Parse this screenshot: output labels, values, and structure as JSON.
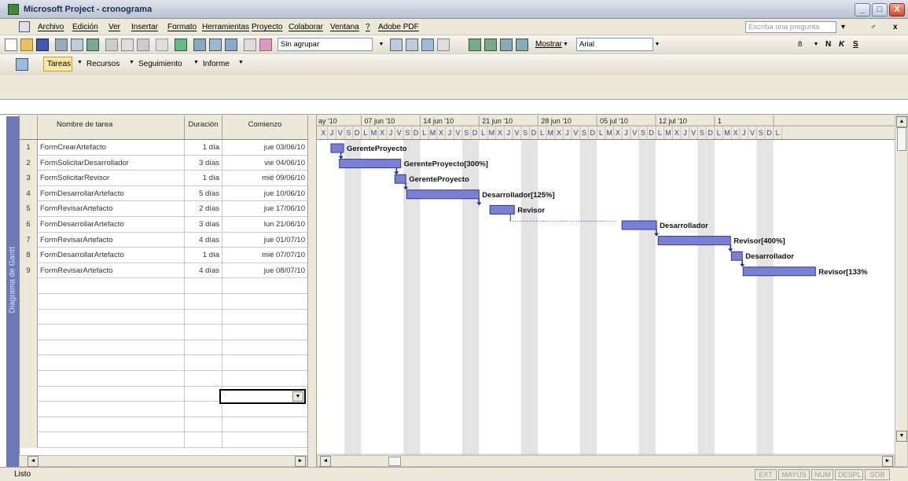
{
  "app_title": "Microsoft Project - cronograma",
  "window_buttons": {
    "minimize": "_",
    "maximize": "□",
    "close": "X"
  },
  "menu": [
    "Archivo",
    "Edición",
    "Ver",
    "Insertar",
    "Formato",
    "Herramientas",
    "Proyecto",
    "Colaborar",
    "Ventana",
    "?",
    "Adobe PDF"
  ],
  "ask_placeholder": "Escriba una pregunta",
  "menu_right": {
    "dropdown": "▾",
    "restore": "♂",
    "close": "x"
  },
  "toolbar1": {
    "group_value": "Sin agrupar",
    "show_label": "Mostrar",
    "font_name": "Arial",
    "font_size": "8",
    "bold": "N",
    "italic": "K",
    "underline": "S"
  },
  "toolbar2": {
    "tareas": "Tareas",
    "recursos": "Recursos",
    "seguimiento": "Seguimiento",
    "informe": "Informe"
  },
  "view_band_label": "Diagrama de Gantt",
  "table": {
    "headers": {
      "name": "Nombre de tarea",
      "duration": "Duración",
      "start": "Comienzo"
    },
    "rows": [
      {
        "id": "1",
        "name": "FormCrearArtefacto",
        "duration": "1 día",
        "start": "jue 03/06/10"
      },
      {
        "id": "2",
        "name": "FormSolicitarDesarrollador",
        "duration": "3 días",
        "start": "vie 04/06/10"
      },
      {
        "id": "3",
        "name": "FormSolicitarRevisor",
        "duration": "1 día",
        "start": "mié 09/06/10"
      },
      {
        "id": "4",
        "name": "FormDesarrollarArtefacto",
        "duration": "5 días",
        "start": "jue 10/06/10"
      },
      {
        "id": "5",
        "name": "FormRevisarArtefacto",
        "duration": "2 días",
        "start": "jue 17/06/10"
      },
      {
        "id": "6",
        "name": "FormDesarrollarArtefacto",
        "duration": "3 días",
        "start": "lun 21/06/10"
      },
      {
        "id": "7",
        "name": "FormRevisarArtefacto",
        "duration": "4 días",
        "start": "jue 01/07/10"
      },
      {
        "id": "8",
        "name": "FormDesarrollarArtefacto",
        "duration": "1 día",
        "start": "mié 07/07/10"
      },
      {
        "id": "9",
        "name": "FormRevisarArtefacto",
        "duration": "4 días",
        "start": "jue 08/07/10"
      }
    ]
  },
  "gantt": {
    "weeks": [
      "ay '10",
      "07 jun '10",
      "14 jun '10",
      "21 jun '10",
      "28 jun '10",
      "05 jul '10",
      "12 jul '10",
      "1"
    ],
    "days": [
      "X",
      "J",
      "V",
      "S",
      "D",
      "L",
      "M",
      "X",
      "J",
      "V",
      "S",
      "D",
      "L",
      "M",
      "X",
      "J",
      "V",
      "S",
      "D",
      "L",
      "M",
      "X",
      "J",
      "V",
      "S",
      "D",
      "L",
      "M",
      "X",
      "J",
      "V",
      "S",
      "D",
      "L",
      "M",
      "X",
      "J",
      "V",
      "S",
      "D",
      "L",
      "M",
      "X",
      "J",
      "V",
      "S",
      "D",
      "L",
      "M",
      "X",
      "J",
      "V",
      "S",
      "D",
      "L"
    ],
    "bar_labels": [
      "GerenteProyecto",
      "GerenteProyecto[300%]",
      "GerenteProyecto",
      "Desarrollador[125%]",
      "Revisor",
      "Desarrollador",
      "Revisor[400%]",
      "Desarrollador",
      "Revisor[133%"
    ]
  },
  "status": {
    "ready": "Listo",
    "ext": "EXT",
    "mayus": "MAYÚS",
    "num": "NUM",
    "despl": "DESPL",
    "sob": "SOB"
  }
}
